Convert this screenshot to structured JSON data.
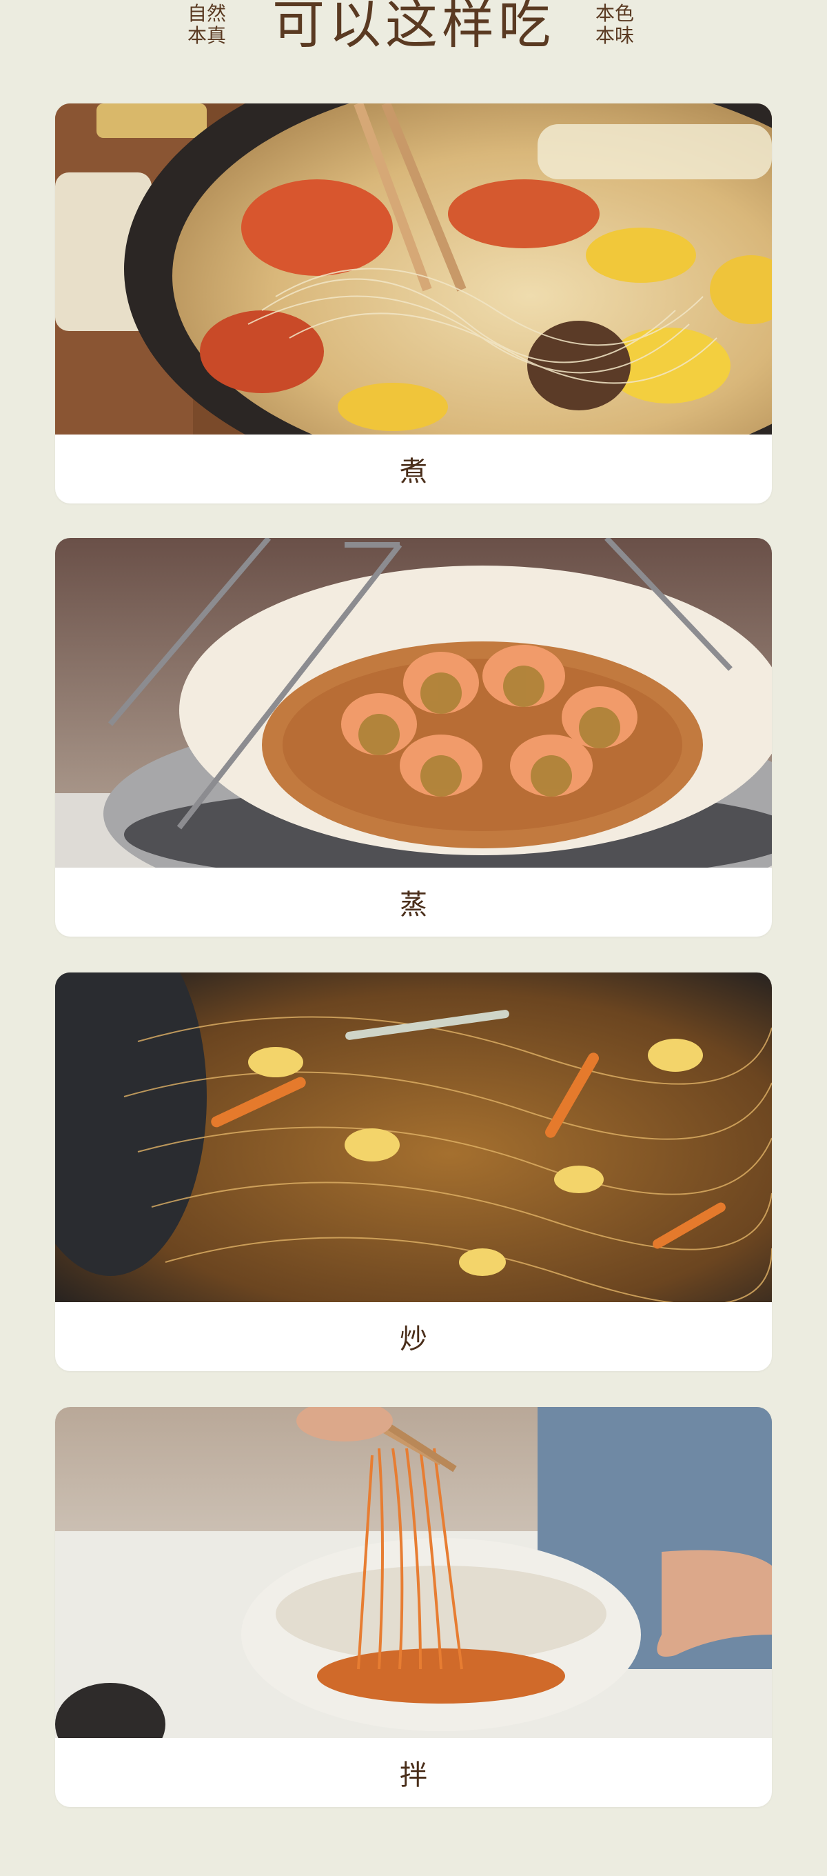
{
  "header": {
    "left_line1": "自然",
    "left_line2": "本真",
    "title": "可以这样吃",
    "right_line1": "本色",
    "right_line2": "本味"
  },
  "cards": [
    {
      "caption": "煮",
      "image": "hotpot-noodles-photo"
    },
    {
      "caption": "蒸",
      "image": "steamed-shrimp-noodles-photo"
    },
    {
      "caption": "炒",
      "image": "stir-fried-noodles-photo"
    },
    {
      "caption": "拌",
      "image": "spicy-mixed-noodles-photo"
    }
  ],
  "colors": {
    "background": "#ecece0",
    "text": "#5a3a22",
    "card": "#ffffff"
  }
}
